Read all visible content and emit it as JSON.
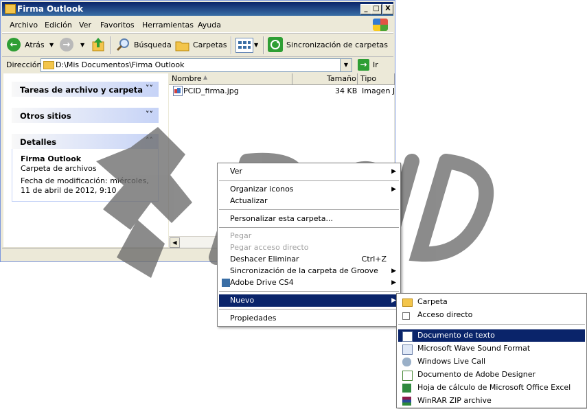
{
  "window": {
    "title": "Firma Outlook",
    "caption_buttons": [
      "_",
      "□",
      "X"
    ]
  },
  "menubar": [
    "Archivo",
    "Edición",
    "Ver",
    "Favoritos",
    "Herramientas",
    "Ayuda"
  ],
  "toolbar": {
    "back": "Atrás",
    "search": "Búsqueda",
    "folders": "Carpetas",
    "sync": "Sincronización de carpetas"
  },
  "address": {
    "label": "Dirección",
    "value": "D:\\Mis Documentos\\Firma Outlook",
    "go": "Ir"
  },
  "leftpane": {
    "tasks": "Tareas de archivo y carpeta",
    "other": "Otros sitios",
    "details": "Detalles",
    "details_name": "Firma Outlook",
    "details_type": "Carpeta de archivos",
    "details_date": "Fecha de modificación: miércoles, 11 de abril de 2012, 9:10"
  },
  "columns": {
    "name": "Nombre",
    "size": "Tamaño",
    "type": "Tipo"
  },
  "files": [
    {
      "name": "PCID_firma.jpg",
      "size": "34 KB",
      "type": "Imagen JI"
    }
  ],
  "context_menu": {
    "ver": "Ver",
    "organizar": "Organizar iconos",
    "actualizar": "Actualizar",
    "personalizar": "Personalizar esta carpeta...",
    "pegar": "Pegar",
    "pegar_acceso": "Pegar acceso directo",
    "deshacer": "Deshacer Eliminar",
    "deshacer_acc": "Ctrl+Z",
    "groove": "Sincronización de la carpeta de Groove",
    "adobe_drive": "Adobe Drive CS4",
    "nuevo": "Nuevo",
    "propiedades": "Propiedades"
  },
  "submenu": {
    "carpeta": "Carpeta",
    "acceso": "Acceso directo",
    "texto": "Documento de texto",
    "wave": "Microsoft Wave Sound Format",
    "live_call": "Windows Live Call",
    "designer": "Documento de Adobe Designer",
    "excel": "Hoja de cálculo de Microsoft Office Excel",
    "winrar": "WinRAR ZIP archive"
  },
  "watermark": "PCID"
}
